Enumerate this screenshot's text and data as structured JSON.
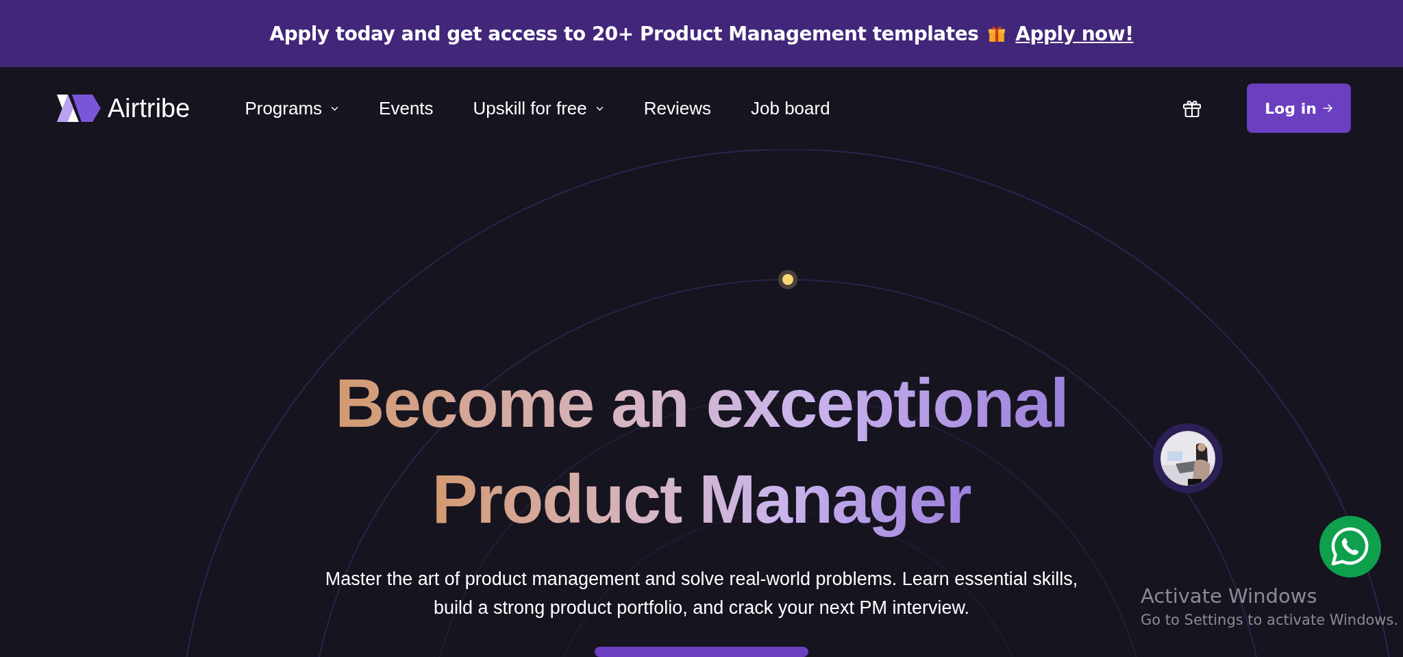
{
  "banner": {
    "text": "Apply today and get access to 20+ Product Management templates",
    "link": "Apply now!"
  },
  "nav": {
    "logo": "Airtribe",
    "items": [
      {
        "label": "Programs",
        "dropdown": true
      },
      {
        "label": "Events",
        "dropdown": false
      },
      {
        "label": "Upskill for free",
        "dropdown": true
      },
      {
        "label": "Reviews",
        "dropdown": false
      },
      {
        "label": "Job board",
        "dropdown": false
      }
    ],
    "login": "Log in"
  },
  "hero": {
    "title_lines": [
      "Become an exceptional",
      "Product Manager"
    ],
    "description": "Master the art of product management and solve real-world problems. Learn essential skills, build a strong product portfolio, and crack your next PM interview."
  },
  "os_notice": {
    "title": "Activate Windows",
    "subtitle": "Go to Settings to activate Windows."
  }
}
